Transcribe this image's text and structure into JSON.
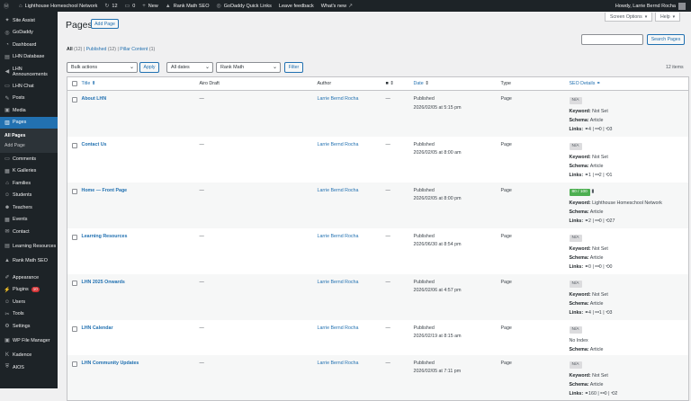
{
  "adminbar": {
    "site": "Lighthouse Homeschool Network",
    "updates": "12",
    "comments": "0",
    "new_label": "New",
    "rank_math": "Rank Math SEO",
    "godaddy_quick": "GoDaddy Quick Links",
    "feedback": "Leave feedback",
    "whats_new": "What's new",
    "howdy": "Howdy, Larrie Bernd Rocha"
  },
  "sidebar": {
    "items": [
      {
        "label": "Site Assist",
        "icon": "assist-icon"
      },
      {
        "label": "GoDaddy",
        "icon": "godaddy-icon"
      },
      {
        "label": "Dashboard",
        "icon": "dashboard-icon"
      },
      {
        "label": "LHN Database",
        "icon": "database-icon"
      },
      {
        "label": "LHN Announcements",
        "icon": "megaphone-icon"
      },
      {
        "label": "LHN Chat",
        "icon": "chat-icon"
      },
      {
        "label": "Posts",
        "icon": "pin-icon"
      },
      {
        "label": "Media",
        "icon": "media-icon"
      },
      {
        "label": "Pages",
        "icon": "pages-icon"
      }
    ],
    "sub": [
      "All Pages",
      "Add Page"
    ],
    "items2": [
      {
        "label": "Comments",
        "icon": "comment-icon"
      },
      {
        "label": "K Galleries",
        "icon": "gallery-icon"
      },
      {
        "label": "Families",
        "icon": "families-icon"
      },
      {
        "label": "Students",
        "icon": "students-icon"
      },
      {
        "label": "Teachers",
        "icon": "teachers-icon"
      },
      {
        "label": "Events",
        "icon": "events-icon"
      },
      {
        "label": "Contact",
        "icon": "contact-icon"
      },
      {
        "label": "Learning Resources",
        "icon": "resources-icon"
      },
      {
        "label": "Rank Math SEO",
        "icon": "rankmath-icon"
      }
    ],
    "items3": [
      {
        "label": "Appearance",
        "icon": "appearance-icon"
      },
      {
        "label": "Plugins",
        "icon": "plugins-icon",
        "badge": "10"
      },
      {
        "label": "Users",
        "icon": "users-icon"
      },
      {
        "label": "Tools",
        "icon": "tools-icon"
      },
      {
        "label": "Settings",
        "icon": "settings-icon"
      },
      {
        "label": "WP File Manager",
        "icon": "filemanager-icon"
      },
      {
        "label": "Kadence",
        "icon": "kadence-icon"
      },
      {
        "label": "AIOS",
        "icon": "aios-icon"
      }
    ]
  },
  "header": {
    "title": "Pages",
    "add_page": "Add Page",
    "screen_options": "Screen Options",
    "help": "Help"
  },
  "filters": {
    "all": "All",
    "all_count": "(12)",
    "published": "Published",
    "published_count": "(12)",
    "pillar": "Pillar Content",
    "pillar_count": "(1)"
  },
  "toolbar": {
    "bulk": "Bulk actions",
    "apply": "Apply",
    "dates": "All dates",
    "rankmath": "Rank Math",
    "filter": "Filter",
    "search_button": "Search Pages",
    "items": "12 items"
  },
  "columns": {
    "title": "Title",
    "airo": "Airo Draft",
    "author": "Author",
    "date": "Date",
    "type": "Type",
    "seo": "SEO Details"
  },
  "rows": [
    {
      "title": "About LHN",
      "airo": "—",
      "author": "Larrie Bernd Rocha",
      "comments": "—",
      "status": "Published",
      "date": "2026/02/05 at 5:15 pm",
      "type": "Page",
      "score": "N/A",
      "score_good": false,
      "keyword": "Not Set",
      "schema": "Article",
      "links": [
        "4",
        "0",
        "3"
      ],
      "noindex": ""
    },
    {
      "title": "Contact Us",
      "airo": "—",
      "author": "Larrie Bernd Rocha",
      "comments": "—",
      "status": "Published",
      "date": "2026/02/05 at 8:00 am",
      "type": "Page",
      "score": "N/A",
      "score_good": false,
      "keyword": "Not Set",
      "schema": "Article",
      "links": [
        "1",
        "2",
        "1"
      ],
      "noindex": ""
    },
    {
      "title": "Home — Front Page",
      "airo": "—",
      "author": "Larrie Bernd Rocha",
      "comments": "—",
      "status": "Published",
      "date": "2026/02/05 at 8:00 pm",
      "type": "Page",
      "score": "80 / 100",
      "score_good": true,
      "keyword": "Lighthouse Homeschool Network",
      "schema": "Article",
      "links": [
        "2",
        "0",
        "27"
      ],
      "noindex": ""
    },
    {
      "title": "Learning Resources",
      "airo": "—",
      "author": "Larrie Bernd Rocha",
      "comments": "—",
      "status": "Published",
      "date": "2026/06/30 at 8:54 pm",
      "type": "Page",
      "score": "N/A",
      "score_good": false,
      "keyword": "Not Set",
      "schema": "Article",
      "links": [
        "0",
        "0",
        "0"
      ],
      "noindex": ""
    },
    {
      "title": "LHN 2025 Onwards",
      "airo": "—",
      "author": "Larrie Bernd Rocha",
      "comments": "—",
      "status": "Published",
      "date": "2026/02/06 at 4:57 pm",
      "type": "Page",
      "score": "N/A",
      "score_good": false,
      "keyword": "Not Set",
      "schema": "Article",
      "links": [
        "4",
        "1",
        "3"
      ],
      "noindex": ""
    },
    {
      "title": "LHN Calendar",
      "airo": "—",
      "author": "Larrie Bernd Rocha",
      "comments": "—",
      "status": "Published",
      "date": "2026/02/19 at 8:15 am",
      "type": "Page",
      "score": "N/A",
      "score_good": false,
      "keyword": "",
      "schema": "Article",
      "links": [],
      "noindex": "No Index"
    },
    {
      "title": "LHN Community Updates",
      "airo": "—",
      "author": "Larrie Bernd Rocha",
      "comments": "—",
      "status": "Published",
      "date": "2026/02/05 at 7:11 pm",
      "type": "Page",
      "score": "N/A",
      "score_good": false,
      "keyword": "Not Set",
      "schema": "Article",
      "links": [
        "160",
        "0",
        "2"
      ],
      "noindex": ""
    }
  ],
  "seo_labels": {
    "keyword": "Keyword:",
    "schema": "Schema:",
    "links": "Links:"
  }
}
